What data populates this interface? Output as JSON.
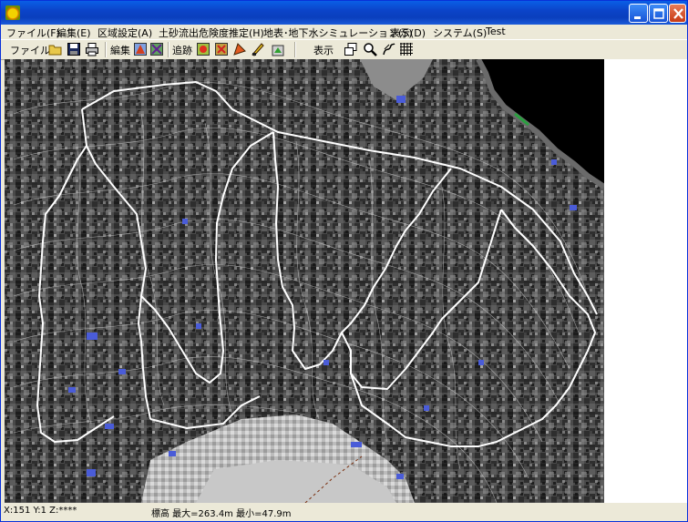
{
  "window": {
    "title": "",
    "buttons": {
      "minimize": "minimize-icon",
      "maximize": "maximize-icon",
      "close": "close-icon"
    }
  },
  "menu": [
    "ファイル(F)",
    "編集(E)",
    "区域設定(A)",
    "土砂流出危険度推定(H)",
    "地表･地下水シミュレーション(S)",
    "表示(D)",
    "システム(S)",
    "Test"
  ],
  "toolbar": {
    "file_label": "ファイル",
    "edit_label": "編集",
    "trace_label": "追跡",
    "view_label": "表示",
    "icons": [
      "open-folder-icon",
      "save-icon",
      "print-icon",
      "edit-map-icon-1",
      "edit-map-icon-2",
      "trace-icon-1",
      "trace-icon-2",
      "trace-icon-3",
      "trace-icon-4",
      "trace-icon-5",
      "window-icon",
      "zoom-icon",
      "pan-icon",
      "grid-icon"
    ]
  },
  "status": {
    "coords": "X:151  Y:1  Z:****",
    "elevation": "標高   最大=263.4m   最小=47.9m"
  },
  "colors": {
    "boundary": "#ffffff",
    "water": "#4a5cd8",
    "flat_land": "#c8c8c8"
  }
}
